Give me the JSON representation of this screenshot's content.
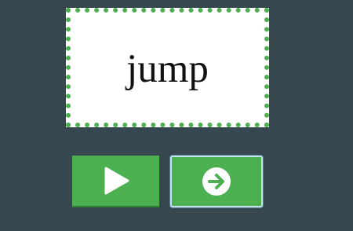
{
  "card": {
    "word": "jump"
  },
  "controls": {
    "play_icon": "play-icon",
    "next_icon": "arrow-right-circle-icon"
  },
  "colors": {
    "background": "#37474f",
    "accent": "#4caf50",
    "card": "#ffffff",
    "focus_outline": "#bfe3f3"
  }
}
